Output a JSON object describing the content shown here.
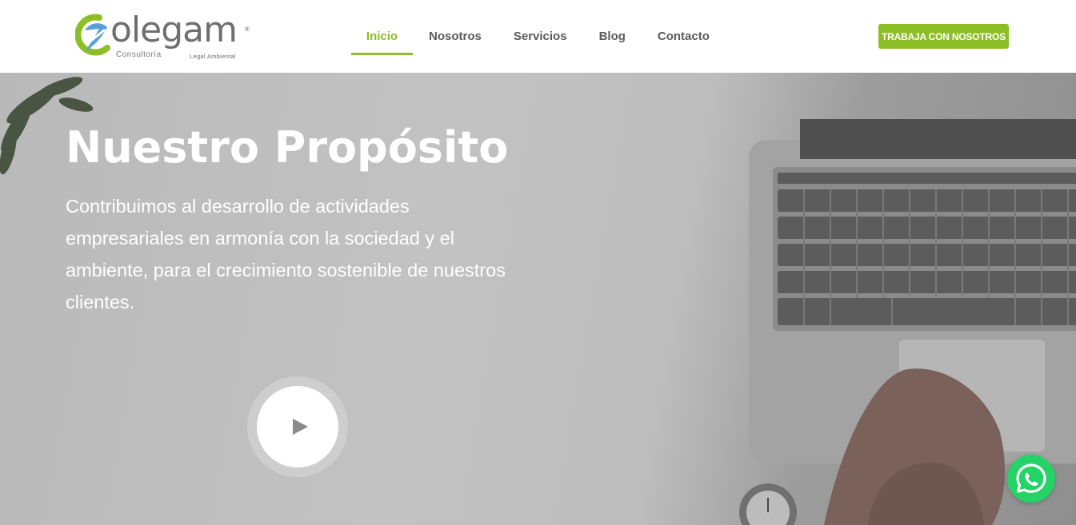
{
  "brand": {
    "name": "olegam",
    "registered": "®",
    "subtitle_left": "Consultoría",
    "subtitle_right": "Legal Ambiental",
    "primary_color": "#8cbf26",
    "logo_blue": "#5aa0d8"
  },
  "nav": {
    "items": [
      {
        "label": "Inicio",
        "active": true
      },
      {
        "label": "Nosotros",
        "active": false
      },
      {
        "label": "Servicios",
        "active": false
      },
      {
        "label": "Blog",
        "active": false
      },
      {
        "label": "Contacto",
        "active": false
      }
    ],
    "cta_label": "TRABAJA CON NOSOTROS"
  },
  "hero": {
    "title": "Nuestro Propósito",
    "text": "Contribuimos al desarrollo de actividades empresariales en armonía con la sociedad y el ambiente, para el crecimiento sostenible de nuestros clientes.",
    "play_icon": "play-icon",
    "background_scene": "laptop-keyboard-desk-plant-icon"
  },
  "floating": {
    "whatsapp_icon": "whatsapp-icon",
    "whatsapp_color": "#25d366"
  }
}
